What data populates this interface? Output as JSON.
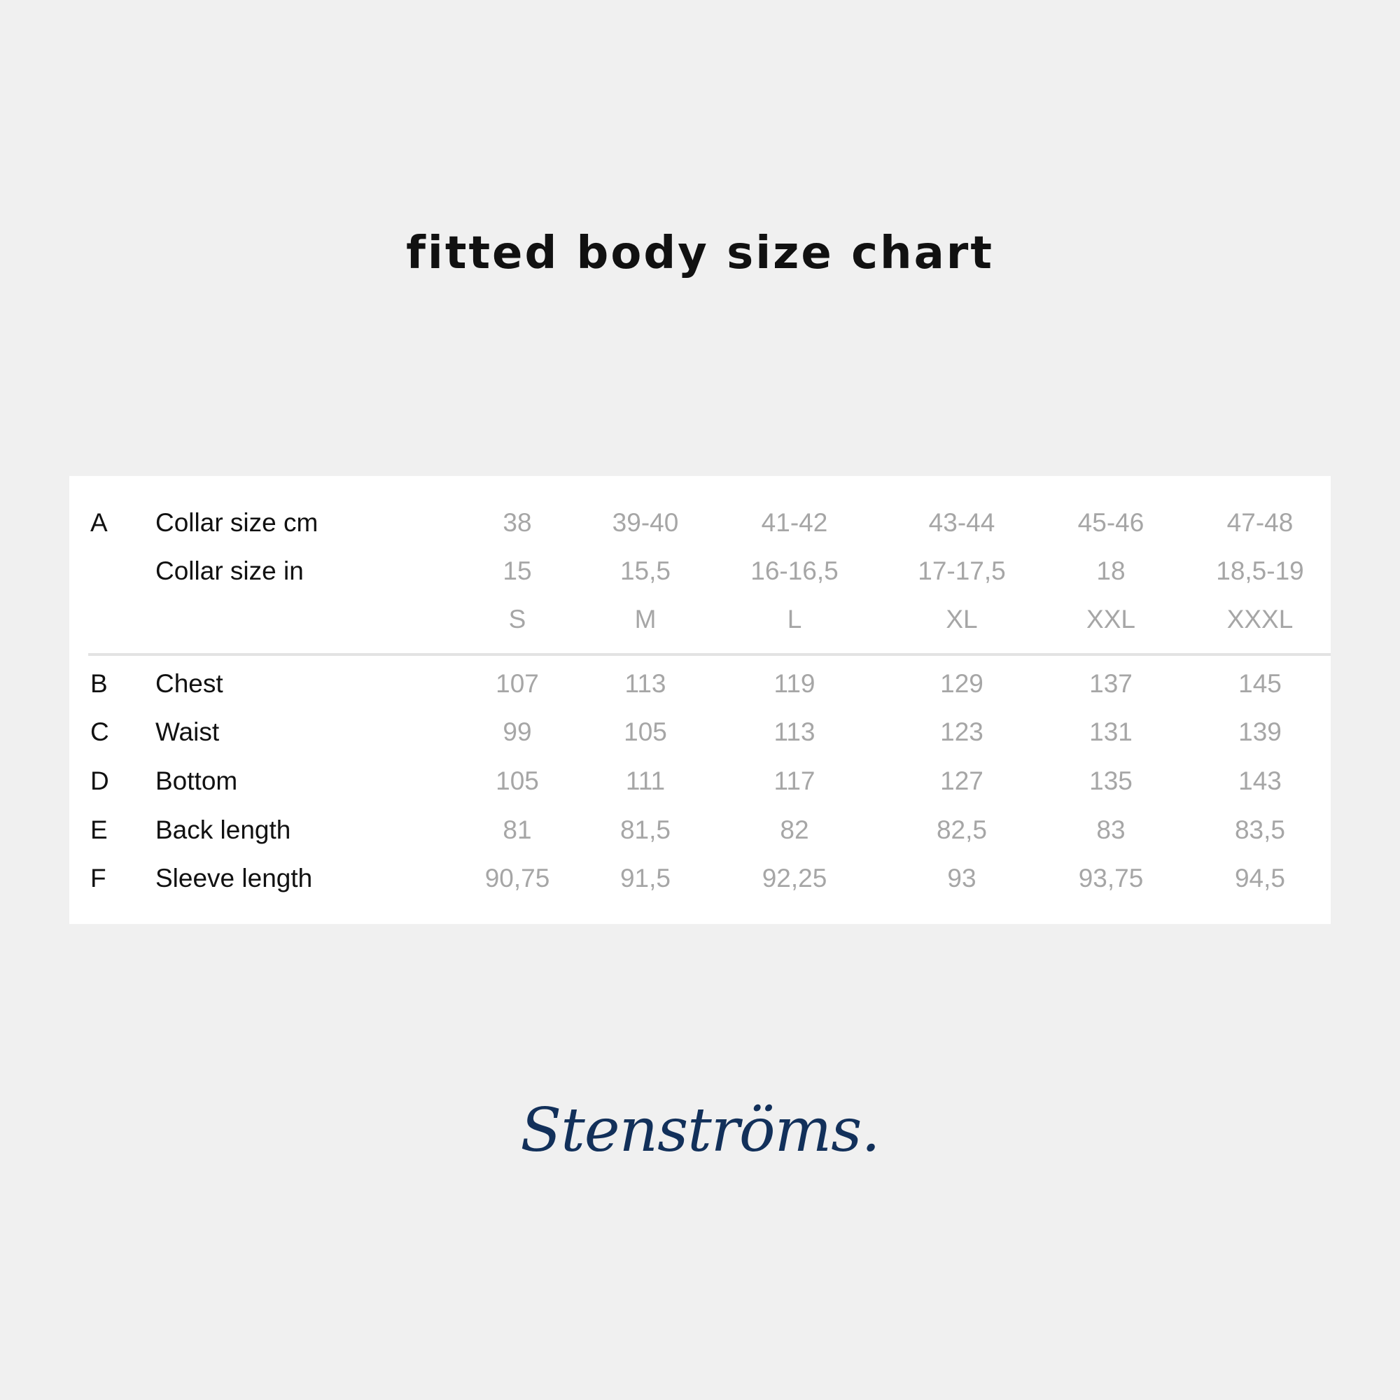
{
  "title": "fitted body size chart",
  "colors": {
    "background": "#f0f0f0",
    "card": "#ffffff",
    "label_text": "#111111",
    "value_text": "#a6a6a6",
    "brand": "#12305a"
  },
  "size_table": {
    "header_rows": [
      {
        "letter": "A",
        "label": "Collar size cm",
        "values": [
          "38",
          "39-40",
          "41-42",
          "43-44",
          "45-46",
          "47-48"
        ]
      },
      {
        "letter": "",
        "label": "Collar size in",
        "values": [
          "15",
          "15,5",
          "16-16,5",
          "17-17,5",
          "18",
          "18,5-19"
        ]
      },
      {
        "letter": "",
        "label": "",
        "values": [
          "S",
          "M",
          "L",
          "XL",
          "XXL",
          "XXXL"
        ]
      }
    ],
    "measurement_rows": [
      {
        "letter": "B",
        "label": "Chest",
        "values": [
          "107",
          "113",
          "119",
          "129",
          "137",
          "145"
        ]
      },
      {
        "letter": "C",
        "label": "Waist",
        "values": [
          "99",
          "105",
          "113",
          "123",
          "131",
          "139"
        ]
      },
      {
        "letter": "D",
        "label": "Bottom",
        "values": [
          "105",
          "111",
          "117",
          "127",
          "135",
          "143"
        ]
      },
      {
        "letter": "E",
        "label": "Back length",
        "values": [
          "81",
          "81,5",
          "82",
          "82,5",
          "83",
          "83,5"
        ]
      },
      {
        "letter": "F",
        "label": "Sleeve length",
        "values": [
          "90,75",
          "91,5",
          "92,25",
          "93",
          "93,75",
          "94,5"
        ]
      }
    ]
  },
  "brand": {
    "name": "Stenströms."
  }
}
